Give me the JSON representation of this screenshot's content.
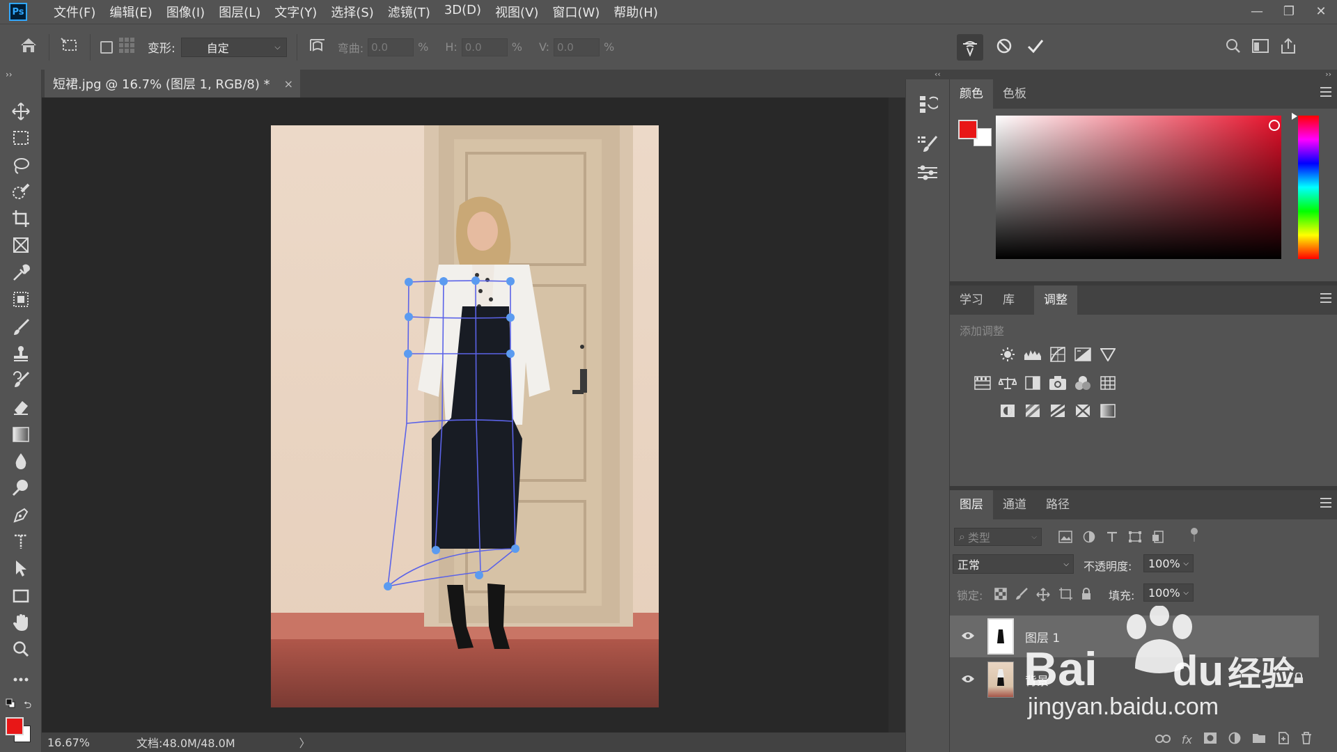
{
  "app": {
    "logo": "Ps"
  },
  "menu": [
    "文件(F)",
    "编辑(E)",
    "图像(I)",
    "图层(L)",
    "文字(Y)",
    "选择(S)",
    "滤镜(T)",
    "3D(D)",
    "视图(V)",
    "窗口(W)",
    "帮助(H)"
  ],
  "window_controls": {
    "minimize": "—",
    "restore": "❐",
    "close": "✕"
  },
  "options": {
    "warp_label": "变形:",
    "warp_value": "自定",
    "bend_label": "弯曲:",
    "bend_value": "0.0",
    "h_label": "H:",
    "h_value": "0.0",
    "v_label": "V:",
    "v_value": "0.0",
    "percent": "%"
  },
  "document": {
    "tab_title": "短裙.jpg @ 16.7% (图层 1, RGB/8) *",
    "close": "×"
  },
  "status": {
    "zoom": "16.67%",
    "doc_size": "文档:48.0M/48.0M",
    "arrow": "〉"
  },
  "color_panel": {
    "tabs": [
      "颜色",
      "色板"
    ],
    "active_tab": "颜色",
    "foreground_color": "#e81717",
    "background_color": "#ffffff",
    "hue_color": "#e8102a"
  },
  "adjust_panel": {
    "tabs": [
      "学习",
      "库",
      "调整"
    ],
    "active_tab": "调整",
    "hint": "添加调整"
  },
  "layers_panel": {
    "tabs": [
      "图层",
      "通道",
      "路径"
    ],
    "active_tab": "图层",
    "filter_placeholder": "类型",
    "blend_mode": "正常",
    "opacity_label": "不透明度:",
    "opacity_value": "100%",
    "lock_label": "锁定:",
    "fill_label": "填充:",
    "fill_value": "100%",
    "layers": [
      {
        "name": "图层 1",
        "selected": true
      },
      {
        "name": "背景",
        "selected": false,
        "locked": true
      }
    ]
  },
  "watermark": {
    "brand": "Bai",
    "brand2": "du",
    "cn": "经验",
    "url": "jingyan.baidu.com"
  }
}
